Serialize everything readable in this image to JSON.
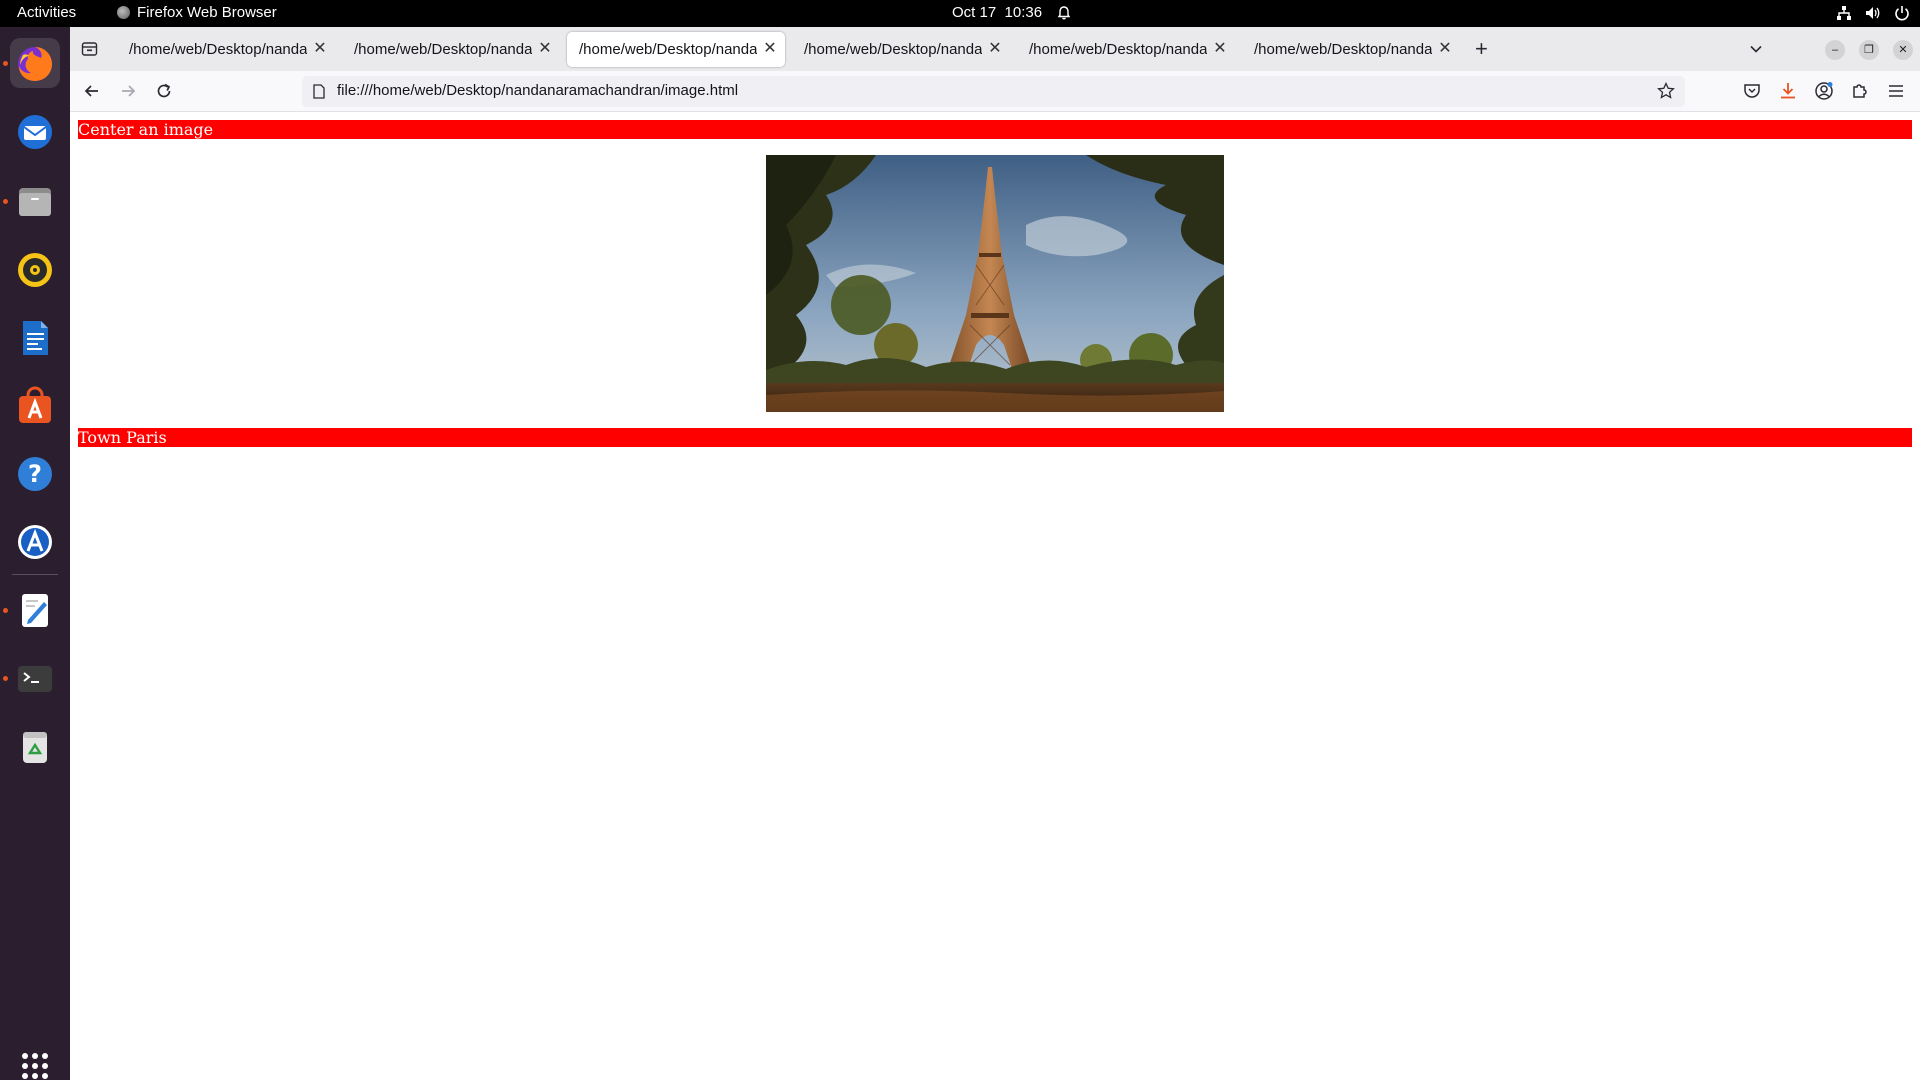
{
  "topbar": {
    "activities": "Activities",
    "app_name": "Firefox Web Browser",
    "date": "Oct 17",
    "time": "10:36"
  },
  "dock": {
    "items": [
      {
        "name": "Firefox",
        "icon": "firefox-icon",
        "running": true
      },
      {
        "name": "Thunderbird",
        "icon": "thunderbird-icon",
        "running": false
      },
      {
        "name": "Files",
        "icon": "files-icon",
        "running": true
      },
      {
        "name": "Rhythmbox",
        "icon": "rhythmbox-icon",
        "running": false
      },
      {
        "name": "LibreOffice Writer",
        "icon": "writer-icon",
        "running": false
      },
      {
        "name": "Ubuntu Software",
        "icon": "software-icon",
        "running": false
      },
      {
        "name": "Help",
        "icon": "help-icon",
        "running": false
      },
      {
        "name": "App Center",
        "icon": "appcenter-icon",
        "running": false
      },
      {
        "name": "Text Editor",
        "icon": "text-editor-icon",
        "running": true
      },
      {
        "name": "Terminal",
        "icon": "terminal-icon",
        "running": true
      },
      {
        "name": "Trash",
        "icon": "trash-icon",
        "running": false
      },
      {
        "name": "Show Apps",
        "icon": "app-grid-icon",
        "running": false
      }
    ]
  },
  "browser": {
    "tabs": [
      {
        "title": "/home/web/Desktop/nandanaramachandran",
        "selected": false
      },
      {
        "title": "/home/web/Desktop/nandanaramachandran",
        "selected": false
      },
      {
        "title": "/home/web/Desktop/nandanaramachandran",
        "selected": true
      },
      {
        "title": "/home/web/Desktop/nandanaramachandran",
        "selected": false
      },
      {
        "title": "/home/web/Desktop/nandanaramachandran",
        "selected": false
      },
      {
        "title": "/home/web/Desktop/nandanaramachandran",
        "selected": false
      }
    ],
    "url": "file:///home/web/Desktop/nandanaramachandran/image.html"
  },
  "page": {
    "heading": "Center an image",
    "caption": "Town Paris",
    "banner_color": "#ff0000",
    "banner_text_color": "#ffffff"
  },
  "colors": {
    "topbar": "#000000",
    "dock": "#2b1e2f",
    "tabstrip": "#eaeaed",
    "accent_orange": "#e95420"
  }
}
